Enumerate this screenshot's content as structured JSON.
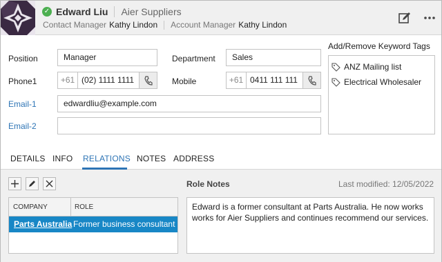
{
  "header": {
    "name": "Edward Liu",
    "company": "Aier Suppliers",
    "contact_manager_label": "Contact Manager",
    "contact_manager": "Kathy Lindon",
    "account_manager_label": "Account Manager",
    "account_manager": "Kathy Lindon",
    "status_icon": "verified-check-icon",
    "status_color": "#4caf50"
  },
  "form": {
    "position_label": "Position",
    "position_value": "Manager",
    "department_label": "Department",
    "department_value": "Sales",
    "phone1_label": "Phone1",
    "phone1_country_code": "+61",
    "phone1_value": "(02) 1111 1111",
    "mobile_label": "Mobile",
    "mobile_country_code": "+61",
    "mobile_value": "0411 111 111",
    "email1_label": "Email-1",
    "email1_value": "edwardliu@example.com",
    "email2_label": "Email-2",
    "email2_value": ""
  },
  "tags": {
    "title": "Add/Remove Keyword Tags",
    "items": [
      "ANZ Mailing list",
      "Electrical Wholesaler"
    ]
  },
  "tabs": [
    {
      "label": "DETAILS",
      "active": false
    },
    {
      "label": "INFO",
      "active": false
    },
    {
      "label": "RELATIONS",
      "active": true
    },
    {
      "label": "NOTES",
      "active": false
    },
    {
      "label": "ADDRESS",
      "active": false
    }
  ],
  "relations": {
    "columns": [
      "COMPANY",
      "ROLE"
    ],
    "rows": [
      {
        "company": "Parts Australia",
        "role": "Former business consultant"
      }
    ],
    "toolbar_icons": [
      "add-icon",
      "edit-icon",
      "delete-icon"
    ]
  },
  "role_notes": {
    "title": "Role Notes",
    "last_modified": "Last modified: 12/05/2022",
    "text": "Edward is a former consultant at Parts Australia. He now works works for Aier Suppliers and continues recommend our services."
  },
  "colors": {
    "accent": "#2d74b5",
    "selection": "#1887c6",
    "header_bg": "#f0f0f0"
  }
}
